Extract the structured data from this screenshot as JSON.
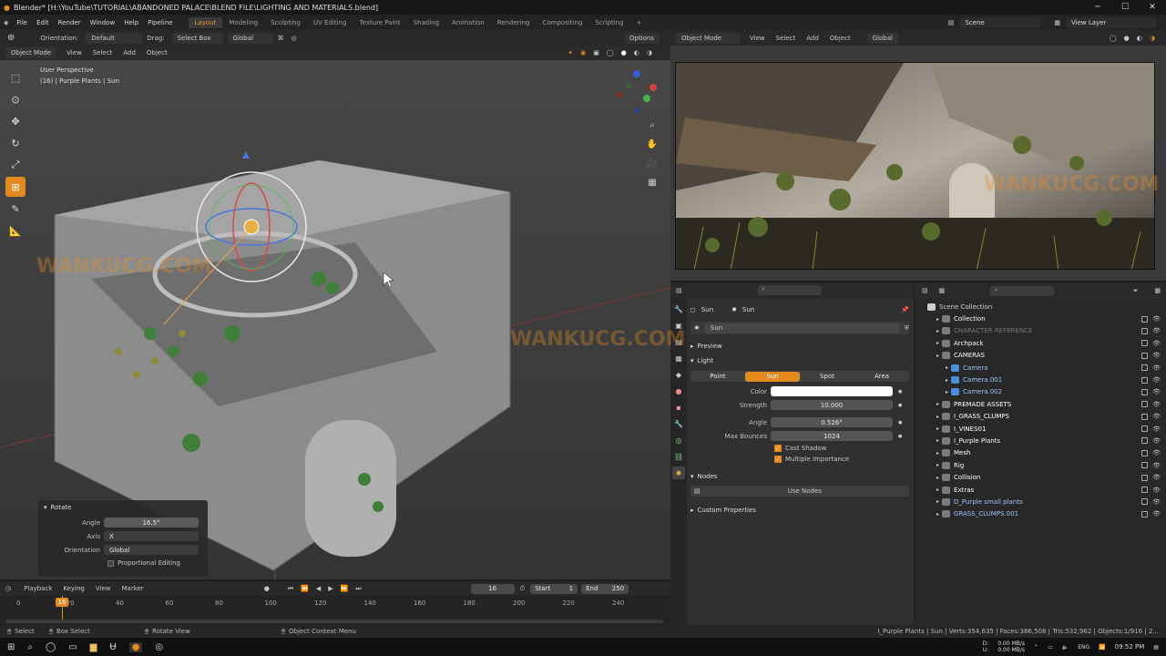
{
  "title_bar": {
    "title": "Blender* [H:\\YouTube\\TUTORIAL\\ABANDONED PALACE\\BLEND FILE\\LIGHTING AND MATERIALS.blend]"
  },
  "menu": {
    "items": [
      "File",
      "Edit",
      "Render",
      "Window",
      "Help",
      "Pipeline"
    ]
  },
  "workspaces": {
    "tabs": [
      "Layout",
      "Modeling",
      "Sculpting",
      "UV Editing",
      "Texture Paint",
      "Shading",
      "Animation",
      "Rendering",
      "Compositing",
      "Scripting"
    ],
    "active": "Layout"
  },
  "scene": {
    "name": "Scene",
    "view_layer": "View Layer"
  },
  "tool_header": {
    "orientation_label": "Orientation:",
    "orientation_value": "Default",
    "drag_label": "Drag:",
    "drag_value": "Select Box",
    "transform": "Global",
    "options": "Options"
  },
  "viewport_header": {
    "mode": "Object Mode",
    "view": "View",
    "select": "Select",
    "add": "Add",
    "object": "Object"
  },
  "viewport": {
    "perspective": "User Perspective",
    "context": "(16) | Purple Plants | Sun"
  },
  "render_header": {
    "mode": "Object Mode",
    "view": "View",
    "select": "Select",
    "add": "Add",
    "object": "Object",
    "transform": "Global"
  },
  "properties": {
    "breadcrumb_obj": "Sun",
    "breadcrumb_data": "Sun",
    "data_name": "Sun",
    "preview": "Preview",
    "light": "Light",
    "light_types": [
      "Point",
      "Sun",
      "Spot",
      "Area"
    ],
    "active_type": "Sun",
    "color_label": "Color",
    "strength_label": "Strength",
    "strength": "10.000",
    "angle_label": "Angle",
    "angle": "0.526°",
    "bounces_label": "Max Bounces",
    "bounces": "1024",
    "cast_shadow": "Cast Shadow",
    "multiple_importance": "Multiple Importance",
    "nodes": "Nodes",
    "use_nodes": "Use Nodes",
    "custom_props": "Custom Properties"
  },
  "outliner": {
    "root": "Scene Collection",
    "items": [
      {
        "name": "Collection",
        "indent": 1
      },
      {
        "name": "CHARACTER REFERENCE",
        "indent": 1
      },
      {
        "name": "Archpack",
        "indent": 1
      },
      {
        "name": "CAMERAS",
        "indent": 1
      },
      {
        "name": "Camera",
        "indent": 2
      },
      {
        "name": "Camera.001",
        "indent": 2
      },
      {
        "name": "Camera.002",
        "indent": 2
      },
      {
        "name": "PREMADE ASSETS",
        "indent": 1
      },
      {
        "name": "I_GRASS_CLUMPS",
        "indent": 1
      },
      {
        "name": "I_VINES01",
        "indent": 1
      },
      {
        "name": "I_Purple Plants",
        "indent": 1
      },
      {
        "name": "Mesh",
        "indent": 1
      },
      {
        "name": "Rig",
        "indent": 1
      },
      {
        "name": "Collision",
        "indent": 1
      },
      {
        "name": "Extras",
        "indent": 1
      },
      {
        "name": "D_Purple small plants",
        "indent": 1
      },
      {
        "name": "GRASS_CLUMPS.001",
        "indent": 1
      }
    ]
  },
  "rotate_panel": {
    "title": "Rotate",
    "angle_label": "Angle",
    "angle": "16.5°",
    "axis_label": "Axis",
    "axis": "X",
    "orientation_label": "Orientation",
    "orientation": "Global",
    "proportional": "Proportional Editing"
  },
  "timeline_header": {
    "playback": "Playback",
    "keying": "Keying",
    "view": "View",
    "marker": "Marker",
    "current_frame": "16",
    "start_label": "Start",
    "start": "1",
    "end_label": "End",
    "end": "250"
  },
  "timeline_ticks": [
    "0",
    "20",
    "40",
    "60",
    "80",
    "100",
    "120",
    "140",
    "160",
    "180",
    "200",
    "220",
    "240"
  ],
  "timeline_current": "16",
  "status": {
    "select": "Select",
    "box_select": "Box Select",
    "rotate_view": "Rotate View",
    "context_menu": "Object Context Menu",
    "stats": "I_Purple Plants | Sun | Verts:354,635 | Faces:386,508 | Tris:532,962 | Objects:1/916 | 2..."
  },
  "taskbar": {
    "net_down": "0.00 MB/s",
    "net_up": "0.00 MB/s",
    "drive_d": "D:",
    "drive_u": "U:",
    "lang": "ENG",
    "time": "09:52 PM"
  },
  "watermark": "WANKUCG.COM",
  "colors": {
    "accent": "#e38a1f",
    "viewport_bg": "#3d3d3d",
    "panel_bg": "#303030"
  }
}
